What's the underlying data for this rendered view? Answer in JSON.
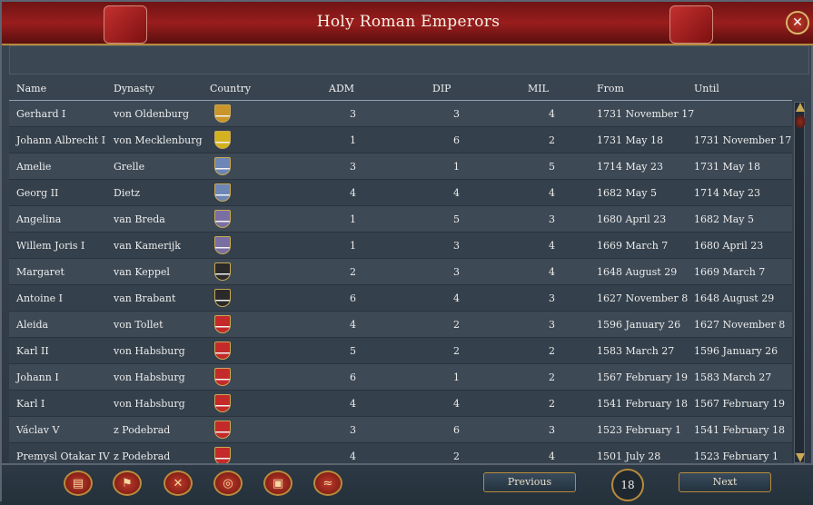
{
  "window": {
    "title": "Holy Roman Emperors",
    "close_icon": "close-icon"
  },
  "table": {
    "headers": [
      "Name",
      "Dynasty",
      "Country",
      "ADM",
      "DIP",
      "MIL",
      "From",
      "Until"
    ],
    "rows": [
      {
        "name": "Gerhard I",
        "dynasty": "von Oldenburg",
        "adm": "3",
        "dip": "3",
        "mil": "4",
        "from": "1731 November 17",
        "until": "",
        "flag": "#c9952a"
      },
      {
        "name": "Johann Albrecht I",
        "dynasty": "von Mecklenburg",
        "adm": "1",
        "dip": "6",
        "mil": "2",
        "from": "1731 May 18",
        "until": "1731 November 17",
        "flag": "#d4b21f"
      },
      {
        "name": "Amelie",
        "dynasty": "Grelle",
        "adm": "3",
        "dip": "1",
        "mil": "5",
        "from": "1714 May 23",
        "until": "1731 May 18",
        "flag": "#6d86b5"
      },
      {
        "name": "Georg II",
        "dynasty": "Dietz",
        "adm": "4",
        "dip": "4",
        "mil": "4",
        "from": "1682 May 5",
        "until": "1714 May 23",
        "flag": "#6d86b5"
      },
      {
        "name": "Angelina",
        "dynasty": "van Breda",
        "adm": "1",
        "dip": "5",
        "mil": "3",
        "from": "1680 April 23",
        "until": "1682 May 5",
        "flag": "#7a6fa3"
      },
      {
        "name": "Willem Joris I",
        "dynasty": "van Kamerijk",
        "adm": "1",
        "dip": "3",
        "mil": "4",
        "from": "1669 March 7",
        "until": "1680 April 23",
        "flag": "#7a6fa3"
      },
      {
        "name": "Margaret",
        "dynasty": "van Keppel",
        "adm": "2",
        "dip": "3",
        "mil": "4",
        "from": "1648 August 29",
        "until": "1669 March 7",
        "flag": "#2a2a2a"
      },
      {
        "name": "Antoine I",
        "dynasty": "van Brabant",
        "adm": "6",
        "dip": "4",
        "mil": "3",
        "from": "1627 November 8",
        "until": "1648 August 29",
        "flag": "#2a2a2a"
      },
      {
        "name": "Aleida",
        "dynasty": "von Tollet",
        "adm": "4",
        "dip": "2",
        "mil": "3",
        "from": "1596 January 26",
        "until": "1627 November 8",
        "flag": "#c42a2a"
      },
      {
        "name": "Karl II",
        "dynasty": "von Habsburg",
        "adm": "5",
        "dip": "2",
        "mil": "2",
        "from": "1583 March 27",
        "until": "1596 January 26",
        "flag": "#c42a2a"
      },
      {
        "name": "Johann I",
        "dynasty": "von Habsburg",
        "adm": "6",
        "dip": "1",
        "mil": "2",
        "from": "1567 February 19",
        "until": "1583 March 27",
        "flag": "#c42a2a"
      },
      {
        "name": "Karl I",
        "dynasty": "von Habsburg",
        "adm": "4",
        "dip": "4",
        "mil": "2",
        "from": "1541 February 18",
        "until": "1567 February 19",
        "flag": "#c42a2a"
      },
      {
        "name": "Václav V",
        "dynasty": "z Podebrad",
        "adm": "3",
        "dip": "6",
        "mil": "3",
        "from": "1523 February 1",
        "until": "1541 February 18",
        "flag": "#c42a2a"
      },
      {
        "name": "Premysl Otakar IV",
        "dynasty": "z Podebrad",
        "adm": "4",
        "dip": "2",
        "mil": "4",
        "from": "1501 July 28",
        "until": "1523 February 1",
        "flag": "#c42a2a"
      }
    ]
  },
  "footer": {
    "tool_icons": [
      "ledger-icon",
      "flag-icon",
      "crossed-swords-icon",
      "coins-icon",
      "chest-icon",
      "handshake-icon"
    ],
    "previous_label": "Previous",
    "page_count": "18",
    "next_label": "Next"
  }
}
